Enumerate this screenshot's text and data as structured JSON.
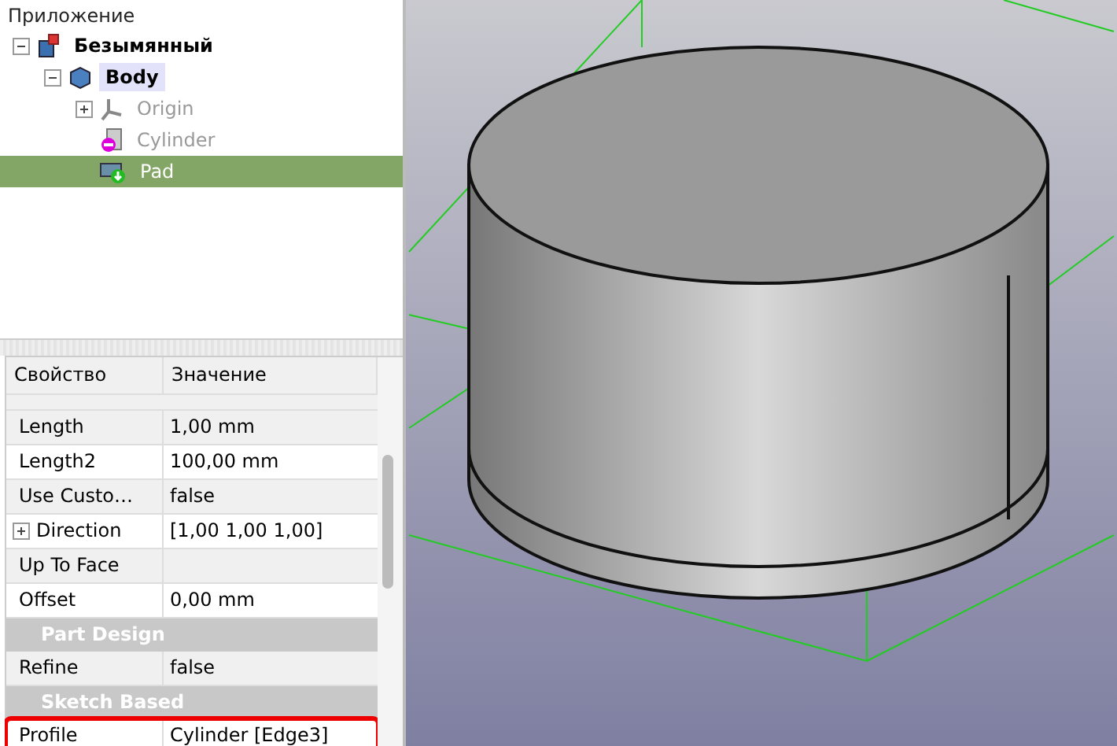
{
  "tree": {
    "title": "Приложение",
    "items": [
      {
        "label": "Безымянный",
        "kind": "document",
        "expanded": true,
        "selected": false,
        "active": false,
        "hidden": false,
        "children": [
          {
            "label": "Body",
            "kind": "body",
            "expanded": true,
            "selected": false,
            "active": true,
            "hidden": false,
            "children": [
              {
                "label": "Origin",
                "kind": "origin",
                "expanded": false,
                "selected": false,
                "active": false,
                "hidden": true
              },
              {
                "label": "Cylinder",
                "kind": "cylinder",
                "selected": false,
                "active": false,
                "hidden": true
              },
              {
                "label": "Pad",
                "kind": "pad",
                "selected": true,
                "active": false,
                "hidden": false
              }
            ]
          }
        ]
      }
    ]
  },
  "properties": {
    "columns": [
      "Свойство",
      "Значение"
    ],
    "rows": [
      {
        "kind": "property",
        "name": "Length",
        "value": "1,00 mm",
        "expandable": false,
        "highlighted": false
      },
      {
        "kind": "property",
        "name": "Length2",
        "value": "100,00 mm",
        "expandable": false,
        "highlighted": false
      },
      {
        "kind": "property",
        "name": "Use Custo…",
        "value": "false",
        "expandable": false,
        "highlighted": false
      },
      {
        "kind": "property",
        "name": "Direction",
        "value": "[1,00 1,00 1,00]",
        "expandable": true,
        "highlighted": false
      },
      {
        "kind": "property",
        "name": "Up To Face",
        "value": "",
        "expandable": false,
        "highlighted": false
      },
      {
        "kind": "property",
        "name": "Offset",
        "value": "0,00 mm",
        "expandable": false,
        "highlighted": false
      },
      {
        "kind": "group",
        "name": "Part Design"
      },
      {
        "kind": "property",
        "name": "Refine",
        "value": "false",
        "expandable": false,
        "highlighted": false
      },
      {
        "kind": "group",
        "name": "Sketch Based"
      },
      {
        "kind": "property",
        "name": "Profile",
        "value": "Cylinder [Edge3]",
        "expandable": false,
        "highlighted": true
      }
    ]
  }
}
